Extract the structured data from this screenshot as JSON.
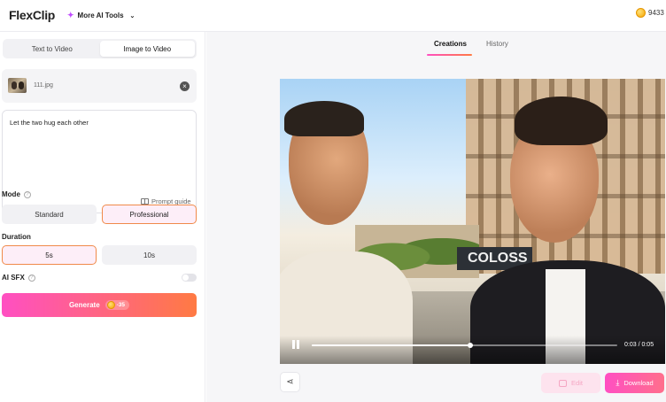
{
  "header": {
    "logo": "FlexClip",
    "more_tools": "More AI Tools",
    "credits": "9433"
  },
  "left_panel": {
    "tabs": [
      {
        "label": "Text to Video",
        "active": false
      },
      {
        "label": "Image to Video",
        "active": true
      }
    ],
    "file": {
      "name": "111.jpg"
    },
    "prompt": {
      "value": "Let the two hug each other",
      "guide_label": "Prompt guide"
    },
    "mode": {
      "label": "Mode",
      "options": [
        {
          "label": "Standard",
          "selected": false
        },
        {
          "label": "Professional",
          "selected": true
        }
      ]
    },
    "duration": {
      "label": "Duration",
      "options": [
        {
          "label": "5s",
          "selected": true
        },
        {
          "label": "10s",
          "selected": false
        }
      ]
    },
    "ai_sfx": {
      "label": "AI SFX",
      "enabled": false
    },
    "generate": {
      "label": "Generate",
      "cost": "-35"
    }
  },
  "right_panel": {
    "tabs": [
      {
        "label": "Creations",
        "active": true
      },
      {
        "label": "History",
        "active": false
      }
    ],
    "player": {
      "time": "0:03 / 0:05",
      "progress": 0.52,
      "sign_text": "COLOSS"
    },
    "actions": {
      "edit_label": "Edit",
      "download_label": "Download"
    }
  },
  "colors": {
    "accent_pink": "#ff4fc2",
    "accent_orange": "#ff7a43",
    "selected_border": "#f08a4a"
  },
  "icons": [
    "sparkle-icon",
    "chevron-down-icon",
    "coin-icon",
    "close-icon",
    "book-icon",
    "help-icon",
    "pause-icon",
    "share-icon",
    "edit-icon",
    "download-icon"
  ]
}
